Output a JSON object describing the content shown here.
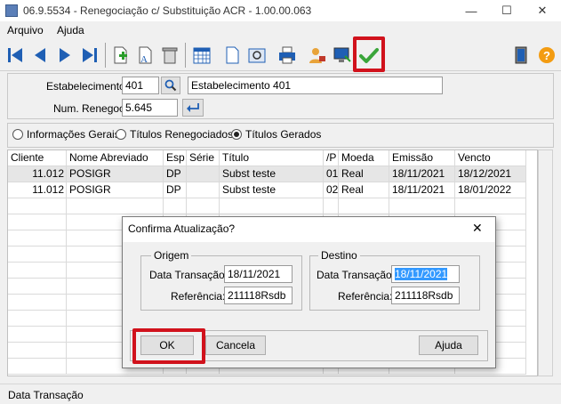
{
  "window": {
    "title": "06.9.5534 - Renegociação c/ Substituição ACR - 1.00.00.063"
  },
  "menu": {
    "items": [
      "Arquivo",
      "Ajuda"
    ]
  },
  "toolbar": {
    "icons": [
      "first-icon",
      "prev-icon",
      "next-icon",
      "last-icon",
      "add-icon",
      "edit-icon",
      "delete-icon",
      "calendar-icon",
      "document-icon",
      "zoom-icon",
      "print-icon",
      "user-icon",
      "monitor-icon",
      "confirm-icon",
      "exit-icon",
      "help-icon"
    ]
  },
  "header": {
    "estabelecimento_label": "Estabelecimento:",
    "estabelecimento_code": "401",
    "estabelecimento_name": "Estabelecimento 401",
    "renegoc_label": "Num. Renegoc:",
    "renegoc_value": "5.645"
  },
  "tabs": {
    "options": [
      "Informações Gerais",
      "Títulos Renegociados",
      "Títulos Gerados"
    ],
    "selected": "Títulos Gerados"
  },
  "grid": {
    "columns": [
      "Cliente",
      "Nome Abreviado",
      "Esp",
      "Série",
      "Título",
      "/P",
      "Moeda",
      "Emissão",
      "Vencto"
    ],
    "rows": [
      [
        "11.012",
        "POSIGR",
        "DP",
        "",
        "Subst teste",
        "01",
        "Real",
        "18/11/2021",
        "18/12/2021"
      ],
      [
        "11.012",
        "POSIGR",
        "DP",
        "",
        "Subst teste",
        "02",
        "Real",
        "18/11/2021",
        "18/01/2022"
      ]
    ]
  },
  "statusbar": {
    "text": "Data Transação"
  },
  "dialog": {
    "title": "Confirma Atualização?",
    "origem": {
      "legend": "Origem",
      "data_label": "Data Transação:",
      "data_value": "18/11/2021",
      "ref_label": "Referência:",
      "ref_value": "211118Rsdb"
    },
    "destino": {
      "legend": "Destino",
      "data_label": "Data Transação:",
      "data_value": "18/11/2021",
      "ref_label": "Referência:",
      "ref_value": "211118Rsdb"
    },
    "ok_label": "OK",
    "cancel_label": "Cancela",
    "help_label": "Ajuda"
  },
  "colors": {
    "highlight": "#d1121c",
    "selection": "#3399ff"
  }
}
